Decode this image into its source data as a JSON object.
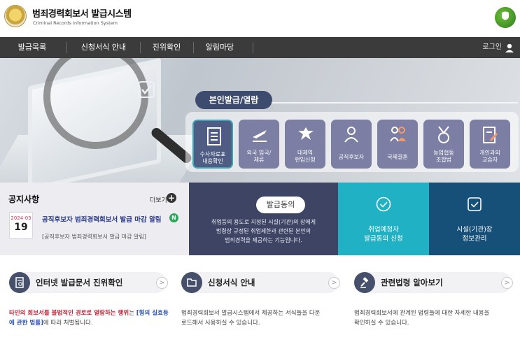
{
  "header": {
    "title": "범죄경력회보서 발급시스템",
    "subtitle": "Criminal Records Information System",
    "emblem_icon": "national-emblem-icon",
    "brand_icon": "green-brand-badge-icon"
  },
  "nav": {
    "items": [
      "발급목록",
      "신청서식 안내",
      "진위확인",
      "알림마당"
    ],
    "login_label": "로그인",
    "user_icon": "user-icon"
  },
  "hero": {
    "section_label": "본인발급/열람",
    "services": [
      {
        "label_1": "수사자료표",
        "label_2": "내용확인",
        "icon": "document-list-icon",
        "active": true
      },
      {
        "label_1": "외국 입국/",
        "label_2": "체류",
        "icon": "airplane-icon",
        "active": false
      },
      {
        "label_1": "대체역",
        "label_2": "편입신청",
        "icon": "military-eagle-icon",
        "active": false
      },
      {
        "label_1": "공직후보자",
        "label_2": "",
        "icon": "person-icon",
        "active": false
      },
      {
        "label_1": "국제결혼",
        "label_2": "",
        "icon": "couple-icon",
        "active": false
      },
      {
        "label_1": "농업협동",
        "label_2": "조합법",
        "icon": "medal-icon",
        "active": false
      },
      {
        "label_1": "개인과외",
        "label_2": "교습자",
        "icon": "edit-note-icon",
        "active": false
      }
    ]
  },
  "notice": {
    "title": "공지사항",
    "more_label": "더보기",
    "date_ym": "2024-03",
    "date_d": "19",
    "headline": "공직후보자 범죄경력회보서 발급 마감 알림",
    "new_badge": "N",
    "subline": "[공직후보자 범죄경력회보서 발급 마감 알림]"
  },
  "consent": {
    "pill": "발급동의",
    "desc_1": "취업등의 용도로 지정된 시설(기관)의 장에게",
    "desc_2": "법령상 규정된 취업제한과 관련된 본인의",
    "desc_3": "범죄경력을 제공하는 기능입니다."
  },
  "tiles": [
    {
      "line_1": "취업예정자",
      "line_2": "발급동의 신청",
      "icon": "check-circle-icon",
      "color": "#20b1c4"
    },
    {
      "line_1": "시설(기관)장",
      "line_2": "정보관리",
      "icon": "check-square-icon",
      "color": "#164f78"
    }
  ],
  "cards": [
    {
      "title": "인터넷 발급문서 진위확인",
      "icon": "document-check-icon",
      "desc_red": "타인의 회보서를 불법적인 경로로 열람하는 행위",
      "desc_mid": "는 ",
      "desc_blue": "[형의 실효등에 관한 법률]",
      "desc_end": "에 따라 처벌됩니다."
    },
    {
      "title": "신청서식 안내",
      "icon": "folder-icon",
      "desc_1": "범죄경력회보서 발급시스템에서 제공하는 서식들을 다운",
      "desc_2": "로드해서 사용하실 수 있습니다."
    },
    {
      "title": "관련법령 알아보기",
      "icon": "gavel-icon",
      "desc_1": "범죄경력회보서에 관계된 법령들에 대한 자세한 내용을",
      "desc_2": "확인하실 수 있습니다."
    }
  ],
  "colors": {
    "nav_bg": "#3b3b3b",
    "accent_navy": "#3e4564",
    "accent_teal": "#20b1c4",
    "accent_blue": "#164f78",
    "service_tile": "#7c7ea3",
    "new_badge": "#2ca65a",
    "date_red": "#d02f5e"
  }
}
